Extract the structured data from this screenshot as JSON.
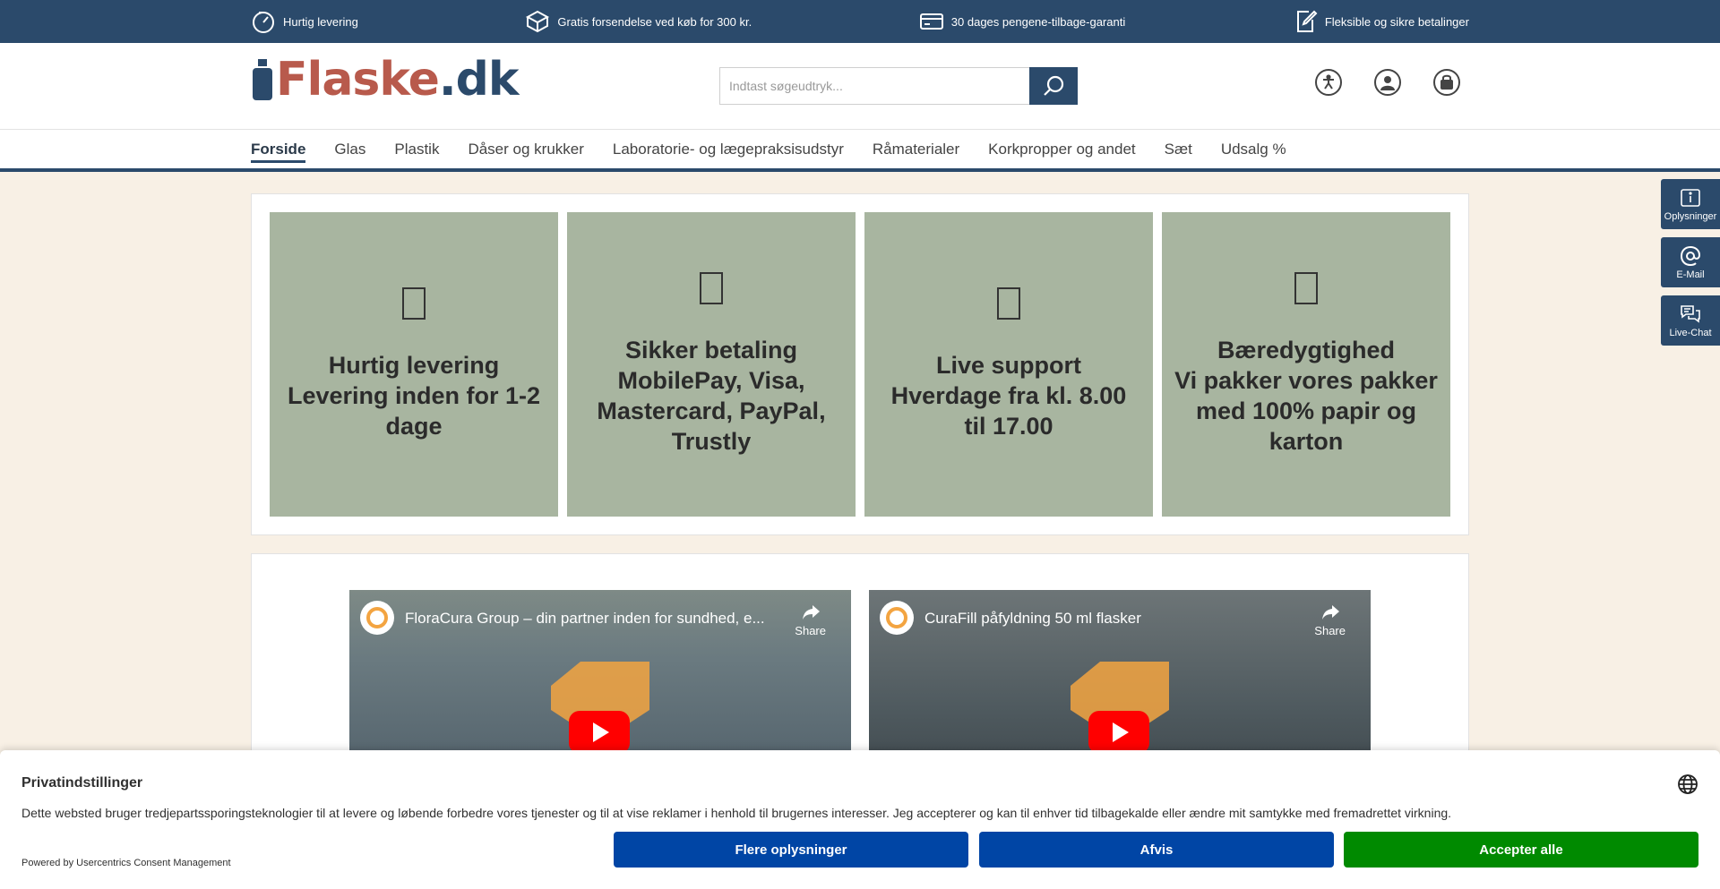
{
  "usp": [
    {
      "icon": "speedometer-icon",
      "text": "Hurtig levering"
    },
    {
      "icon": "box-icon",
      "text": "Gratis forsendelse ved køb for 300 kr."
    },
    {
      "icon": "credit-card-icon",
      "text": "30 dages pengene-tilbage-garanti"
    },
    {
      "icon": "edit-document-icon",
      "text": "Fleksible og sikre betalinger"
    }
  ],
  "logo": {
    "part1": "Flaske",
    "part2": ".dk"
  },
  "search": {
    "placeholder": "Indtast søgeudtryk..."
  },
  "header_icons": [
    "accessibility-icon",
    "account-icon",
    "cart-icon"
  ],
  "nav": [
    "Forside",
    "Glas",
    "Plastik",
    "Dåser og krukker",
    "Laboratorie- og lægepraksisudstyr",
    "Råmaterialer",
    "Korkpropper og andet",
    "Sæt",
    "Udsalg %"
  ],
  "side_tabs": [
    {
      "icon": "info-icon",
      "label": "Oplysninger"
    },
    {
      "icon": "email-icon",
      "label": "E-Mail"
    },
    {
      "icon": "chat-icon",
      "label": "Live-Chat"
    }
  ],
  "features": [
    {
      "title": "Hurtig levering\nLevering inden for 1-2 dage"
    },
    {
      "title": "Sikker betaling\nMobilePay, Visa, Mastercard, PayPal, Trustly"
    },
    {
      "title": "Live support\nHverdage fra kl. 8.00 til 17.00"
    },
    {
      "title": "Bæredygtighed\nVi pakker vores pakker med 100% papir og karton"
    }
  ],
  "videos": [
    {
      "title": "FloraCura Group – din partner inden for sundhed, e...",
      "share": "Share"
    },
    {
      "title": "CuraFill påfyldning 50 ml flasker",
      "share": "Share"
    }
  ],
  "consent": {
    "title": "Privatindstillinger",
    "text": "Dette websted bruger tredjepartssporingsteknologier til at levere og løbende forbedre vores tjenester og til at vise reklamer i henhold til brugernes interesser. Jeg accepterer og kan til enhver tid tilbagekalde eller ændre mit samtykke med fremadrettet virkning.",
    "powered": "Powered by Usercentrics Consent Management",
    "more": "Flere oplysninger",
    "deny": "Afvis",
    "accept": "Accepter alle"
  },
  "colors": {
    "primary": "#2b4a6b",
    "logo_red": "#b85a4c",
    "tile": "#a8b5a0",
    "accept": "#008a00",
    "consent_blue": "#0045a5",
    "background": "#f8f0e5"
  }
}
